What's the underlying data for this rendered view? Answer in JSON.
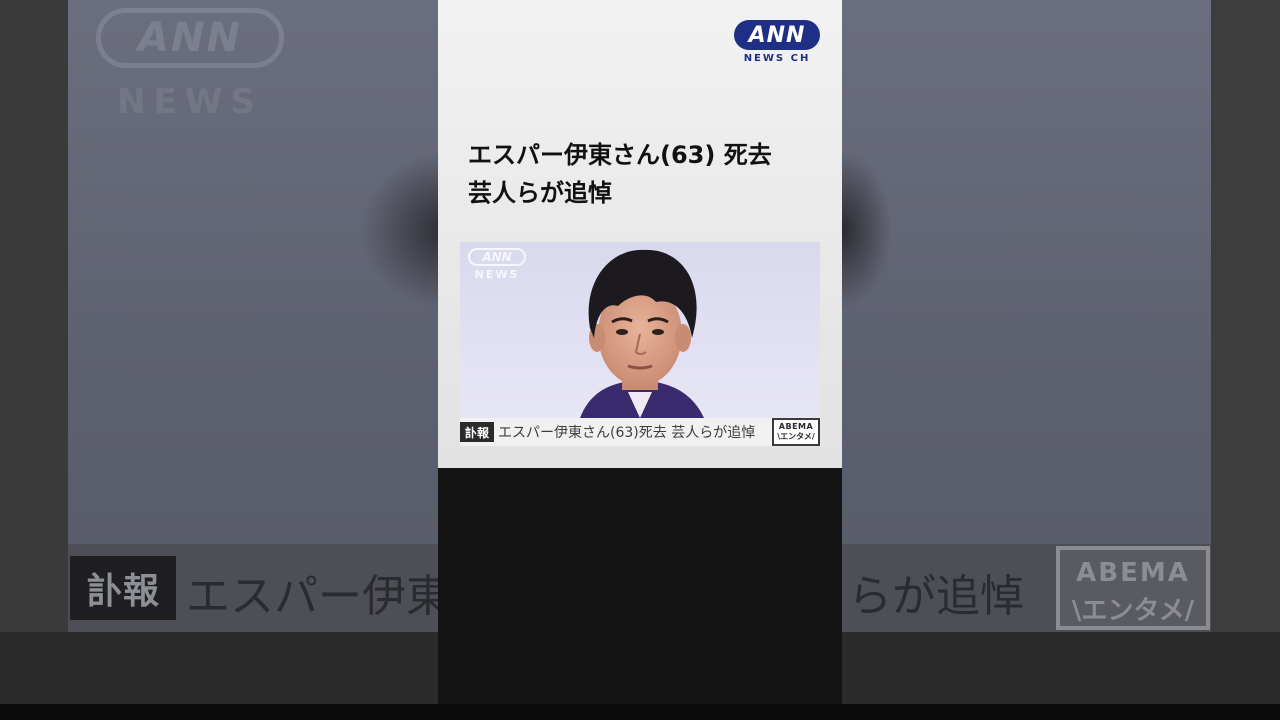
{
  "background": {
    "watermark": {
      "logo": "ANN",
      "sub": "NEWS"
    },
    "ticker": {
      "badge": "訃報",
      "text_left": "エスパー伊東",
      "text_right": "らが追悼",
      "abema_top": "ABEMA",
      "abema_bottom": "\\エンタメ/"
    }
  },
  "card": {
    "logo": {
      "brand": "ANN",
      "channel": "NEWS CH",
      "color": "#1f2f86"
    },
    "headline": {
      "line1": "エスパー伊東さん(63) 死去",
      "line2": "芸人らが追悼"
    },
    "thumbnail": {
      "watermark_logo": "ANN",
      "watermark_sub": "NEWS",
      "caption_badge": "訃報",
      "caption_text": "エスパー伊東さん(63)死去 芸人らが追悼",
      "abema_top": "ABEMA",
      "abema_bottom": "\\エンタメ/"
    }
  }
}
